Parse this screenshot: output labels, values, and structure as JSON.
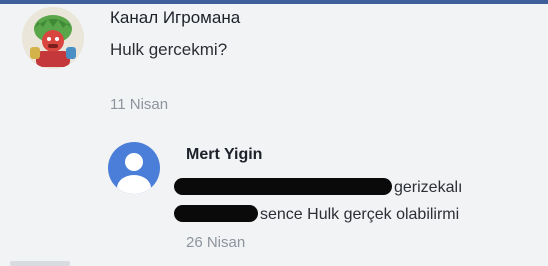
{
  "post": {
    "author": "Канал Игромана",
    "text": "Hulk gercekmi?",
    "date": "11 Nisan"
  },
  "reply": {
    "author": "Mert Yigin",
    "line1_text": "gerizekalı",
    "line2_text": "sence Hulk gerçek olabilirmi",
    "date": "26 Nisan"
  },
  "colors": {
    "topbar": "#3f5f9a",
    "default_avatar": "#4a7ed8"
  }
}
